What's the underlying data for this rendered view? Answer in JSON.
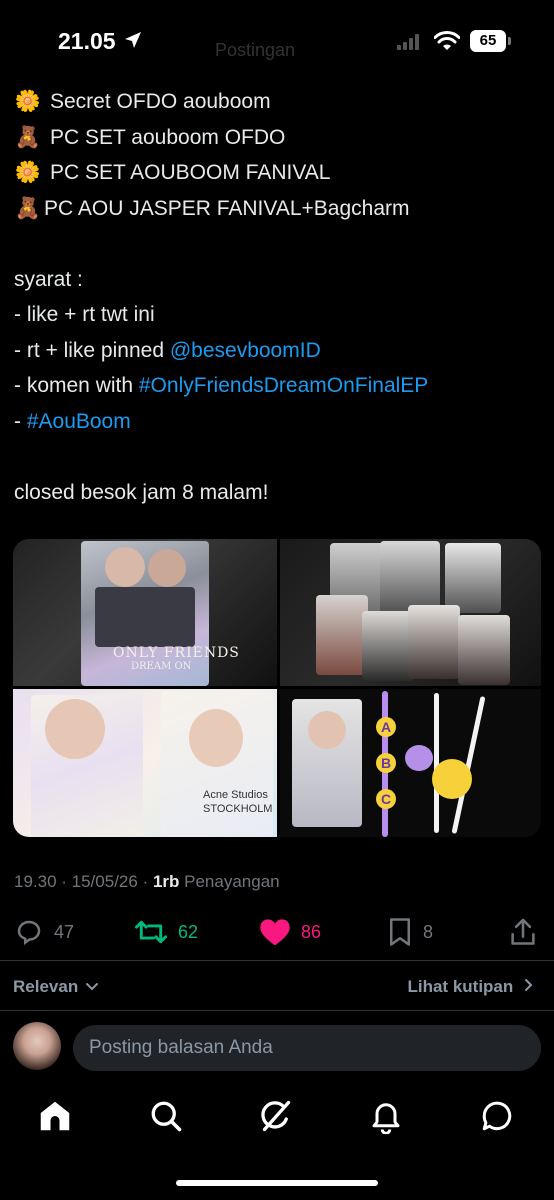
{
  "status_bar": {
    "time": "21.05",
    "title_ghost": "Postingan",
    "battery": "65"
  },
  "tweet": {
    "lines": [
      {
        "emoji": "🌼",
        "text": "Secret OFDO aouboom"
      },
      {
        "emoji": "🧸",
        "text": "PC SET aouboom OFDO"
      },
      {
        "emoji": "🌼",
        "text": "PC SET AOUBOOM FANIVAL"
      },
      {
        "emoji": "🧸",
        "text": "PC AOU JASPER FANIVAL+Bagcharm"
      }
    ],
    "syarat_heading": "syarat :",
    "rule1": "- like + rt twt ini",
    "rule2_prefix": "- rt + like pinned ",
    "rule2_mention": "@besevboomID",
    "rule3_prefix": "- komen with ",
    "rule3_hashtag": "#OnlyFriendsDreamOnFinalEP",
    "rule4_prefix": "- ",
    "rule4_hashtag": "#AouBoom",
    "closing": "closed besok jam 8 malam!"
  },
  "media": {
    "tile1_text": "ONLY FRIENDS",
    "tile1_sub": "DREAM ON",
    "tile3_text1": "Acne Studios",
    "tile3_text2": "STOCKHOLM",
    "tile4_letters": [
      "A",
      "B",
      "C"
    ]
  },
  "meta": {
    "timestamp": "19.30 · 15/05/26 · ",
    "views_count": "1rb",
    "views_label": " Penayangan"
  },
  "actions": {
    "replies": "47",
    "reposts": "62",
    "likes": "86",
    "bookmarks": "8"
  },
  "colors": {
    "link": "#1d9bf0",
    "repost": "#00ba7c",
    "like": "#f91880",
    "muted": "#71767b"
  },
  "sort": {
    "label": "Relevan",
    "quotes": "Lihat kutipan"
  },
  "reply": {
    "placeholder": "Posting balasan Anda"
  },
  "nav": [
    "home-icon",
    "search-icon",
    "grok-icon",
    "notifications-icon",
    "messages-icon"
  ]
}
